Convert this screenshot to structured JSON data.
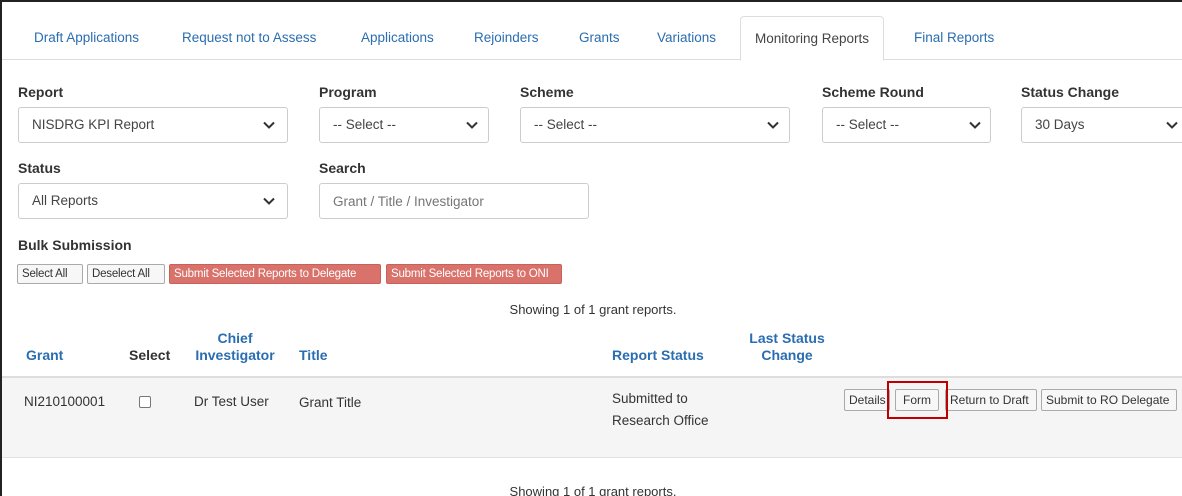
{
  "tabs": [
    {
      "label": "Draft Applications"
    },
    {
      "label": "Request not to Assess"
    },
    {
      "label": "Applications"
    },
    {
      "label": "Rejoinders"
    },
    {
      "label": "Grants"
    },
    {
      "label": "Variations"
    },
    {
      "label": "Monitoring Reports",
      "active": true
    },
    {
      "label": "Final Reports"
    }
  ],
  "filters": {
    "report": {
      "label": "Report",
      "value": "NISDRG KPI Report"
    },
    "program": {
      "label": "Program",
      "value": "-- Select --"
    },
    "scheme": {
      "label": "Scheme",
      "value": "-- Select --"
    },
    "scheme_round": {
      "label": "Scheme Round",
      "value": "-- Select --"
    },
    "status_change": {
      "label": "Status Change",
      "value": "30 Days"
    },
    "status": {
      "label": "Status",
      "value": "All Reports"
    },
    "search": {
      "label": "Search",
      "placeholder": "Grant / Title / Investigator",
      "value": ""
    }
  },
  "bulk": {
    "label": "Bulk Submission",
    "select_all": "Select All",
    "deselect_all": "Deselect All",
    "submit_delegate": "Submit Selected Reports to Delegate",
    "submit_oni": "Submit Selected Reports to ONI"
  },
  "showing_top": "Showing 1 of 1 grant reports.",
  "showing_bottom": "Showing 1 of 1 grant reports.",
  "table": {
    "headers": {
      "grant": "Grant",
      "select": "Select",
      "ci_line1": "Chief",
      "ci_line2": "Investigator",
      "title": "Title",
      "report_status": "Report Status",
      "last_line1": "Last Status",
      "last_line2": "Change"
    },
    "rows": [
      {
        "grant": "NI210100001",
        "selected": false,
        "ci": "Dr Test User",
        "title": "Grant Title",
        "status_line1": "Submitted to",
        "status_line2": "Research Office",
        "last_change": "",
        "actions": {
          "details": "Details",
          "form": "Form",
          "return_draft": "Return to Draft",
          "submit_ro": "Submit to RO Delegate"
        }
      }
    ]
  },
  "colors": {
    "link": "#2a6db0",
    "danger_button": "#d9726b",
    "highlight": "#c00000"
  }
}
